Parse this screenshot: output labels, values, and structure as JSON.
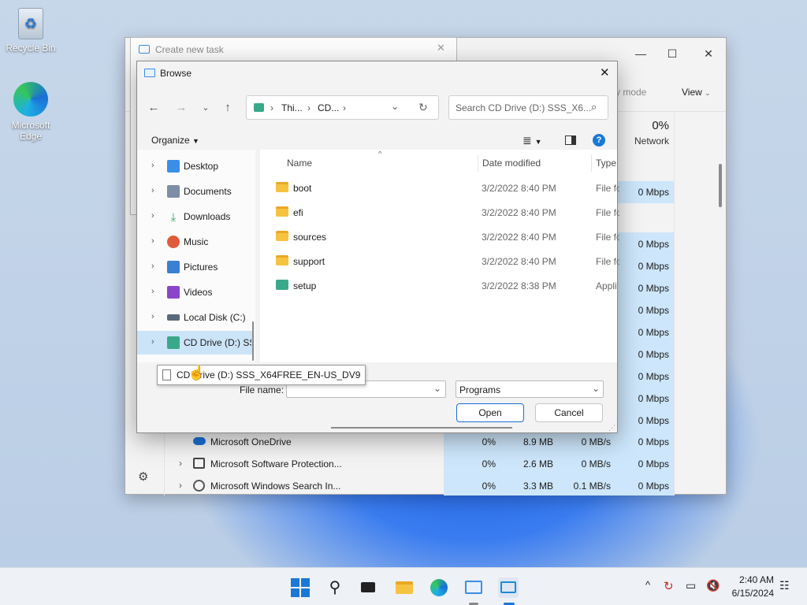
{
  "desktop": {
    "icons": [
      {
        "label": "Recycle Bin",
        "icon": "recycle-bin-icon"
      },
      {
        "label": "Microsoft Edge",
        "icon": "edge-icon"
      }
    ]
  },
  "task_manager": {
    "toolbar": {
      "efficiency_label": "cy mode",
      "view_label": "View"
    },
    "network_header": {
      "percent": "0%",
      "label": "Network"
    },
    "top_rows_network": [
      "0 Mbps",
      "0 Mbps",
      "0 Mbps",
      "0 Mbps",
      "0 Mbps",
      "0 Mbps",
      "0 Mbps",
      "0 Mbps",
      "0 Mbps",
      "0 Mbps"
    ],
    "processes": [
      {
        "name": "Microsoft OneDrive",
        "cpu": "0%",
        "memory": "8.9 MB",
        "disk": "0 MB/s",
        "network": "0 Mbps"
      },
      {
        "name": "Microsoft Software Protection...",
        "cpu": "0%",
        "memory": "2.6 MB",
        "disk": "0 MB/s",
        "network": "0 Mbps"
      },
      {
        "name": "Microsoft Windows Search In...",
        "cpu": "0%",
        "memory": "3.3 MB",
        "disk": "0.1 MB/s",
        "network": "0 Mbps"
      }
    ]
  },
  "create_task": {
    "title": "Create new task"
  },
  "browse": {
    "title": "Browse",
    "breadcrumb": [
      "Thi...",
      "CD..."
    ],
    "search_placeholder": "Search CD Drive (D:) SSS_X6...",
    "organize_label": "Organize",
    "tree": [
      {
        "label": "Desktop",
        "icon": "desktop-icon",
        "color": "#3a8ee6"
      },
      {
        "label": "Documents",
        "icon": "documents-icon",
        "color": "#7d8ea6"
      },
      {
        "label": "Downloads",
        "icon": "downloads-icon",
        "color": "#2aa15a"
      },
      {
        "label": "Music",
        "icon": "music-icon",
        "color": "#e05a3c"
      },
      {
        "label": "Pictures",
        "icon": "pictures-icon",
        "color": "#3a7fd0"
      },
      {
        "label": "Videos",
        "icon": "videos-icon",
        "color": "#8b45c9"
      },
      {
        "label": "Local Disk (C:)",
        "icon": "local-disk-icon",
        "color": "#5a6a7a"
      },
      {
        "label": "CD Drive (D:) SS",
        "icon": "cd-drive-icon",
        "color": "#3aa88a"
      }
    ],
    "columns": {
      "name": "Name",
      "date": "Date modified",
      "type": "Type"
    },
    "files": [
      {
        "name": "boot",
        "date": "3/2/2022 8:40 PM",
        "type": "File fo",
        "icon": "folder-icon"
      },
      {
        "name": "efi",
        "date": "3/2/2022 8:40 PM",
        "type": "File fo",
        "icon": "folder-icon"
      },
      {
        "name": "sources",
        "date": "3/2/2022 8:40 PM",
        "type": "File fo",
        "icon": "folder-icon"
      },
      {
        "name": "support",
        "date": "3/2/2022 8:40 PM",
        "type": "File fo",
        "icon": "folder-icon"
      },
      {
        "name": "setup",
        "date": "3/2/2022 8:38 PM",
        "type": "Appli",
        "icon": "setup-icon"
      }
    ],
    "drag_tooltip": "CD Drive (D:) SSS_X64FREE_EN-US_DV9",
    "file_name_label": "File name:",
    "file_name_value": "",
    "filter_value": "Programs",
    "open_label": "Open",
    "cancel_label": "Cancel"
  },
  "taskbar": {
    "time": "2:40 AM",
    "date": "6/15/2024"
  }
}
